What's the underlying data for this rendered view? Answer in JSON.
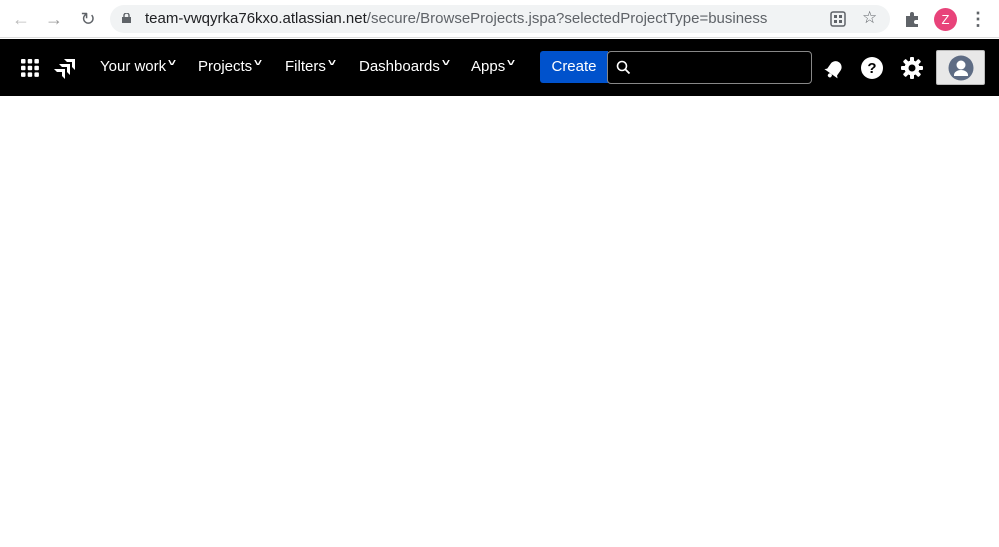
{
  "browser": {
    "url_host": "team-vwqyrka76kxo.atlassian.net",
    "url_path": "/secure/BrowseProjects.jspa?selectedProjectType=business",
    "profile_initial": "Z",
    "profile_color": "#e8437a"
  },
  "nav": {
    "items": [
      {
        "label": "Your work"
      },
      {
        "label": "Projects"
      },
      {
        "label": "Filters"
      },
      {
        "label": "Dashboards"
      },
      {
        "label": "Apps"
      }
    ],
    "chevron": "˅",
    "create_label": "Create",
    "accent": "#0052cc"
  }
}
